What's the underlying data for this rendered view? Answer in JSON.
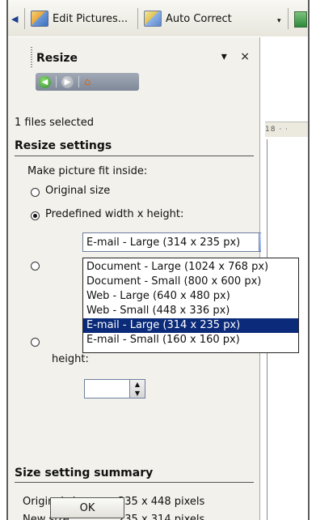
{
  "toolbar": {
    "edit_pictures_label": "Edit Pictures...",
    "auto_correct_label": "Auto Correct"
  },
  "pane": {
    "title": "Resize",
    "controls": "▾ ×",
    "files_selected": "1 files selected",
    "section_resize": "Resize settings",
    "make_fit": "Make picture fit inside:",
    "opt_original": "Original size",
    "opt_predefined": "Predefined width x height:",
    "selected_value": "E-mail - Large (314 x 235 px)",
    "dropdown_options": [
      "Document - Large (1024 x 768 px)",
      "Document - Small (800 x 600 px)",
      "Web - Large (640 x 480 px)",
      "Web - Small (448 x 336 px)",
      "E-mail - Large (314 x 235 px)",
      "E-mail - Small (160 x 160 px)"
    ],
    "height_label": "height:",
    "percent_unit": "%",
    "section_summary": "Size setting summary",
    "original_size_label": "Original size:",
    "original_size_value": "335 x 448 pixels",
    "new_size_label": "New size:",
    "new_size_value": "235 x 314 pixels",
    "ok_label": "OK"
  },
  "doc": {
    "ruler_text": "18 · ·"
  }
}
